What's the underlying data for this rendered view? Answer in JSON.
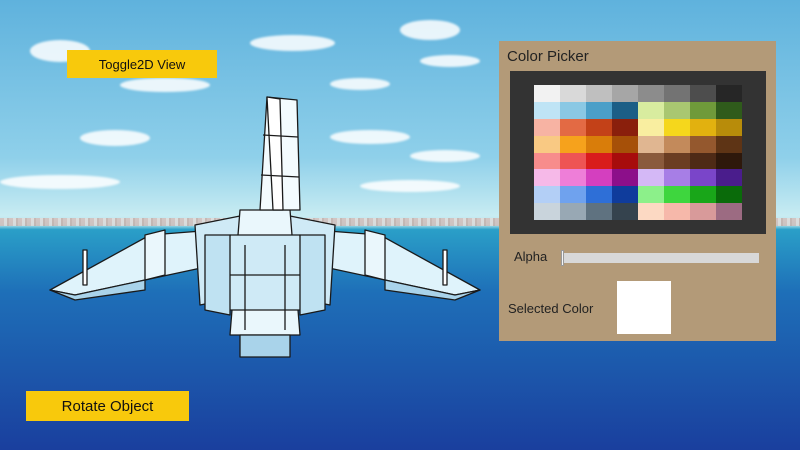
{
  "toolbar": {
    "toggle_label": "Toggle2D View",
    "rotate_label": "Rotate Object"
  },
  "color_picker": {
    "title": "Color Picker",
    "alpha_label": "Alpha",
    "alpha_value": 0,
    "selected_label": "Selected Color",
    "selected_color": "#ffffff",
    "palette": [
      [
        "#f2f2f2",
        "#d9d9d9",
        "#bfbfbf",
        "#a6a6a6",
        "#8c8c8c",
        "#737373",
        "#4d4d4d",
        "#262626"
      ],
      [
        "#bfe4f5",
        "#8ac8e4",
        "#4b9fc8",
        "#1b5e86",
        "#d8ec9f",
        "#a9c771",
        "#6f9a3a",
        "#2f5b1b"
      ],
      [
        "#f7b3a3",
        "#e36a44",
        "#c34118",
        "#8a1f0c",
        "#f9eea0",
        "#f5d71c",
        "#e2b10f",
        "#b88c0a"
      ],
      [
        "#f9c983",
        "#f6a21c",
        "#d97d0a",
        "#a65008",
        "#e0b691",
        "#c38a5b",
        "#94582e",
        "#5e3415"
      ],
      [
        "#f78c8c",
        "#ee5454",
        "#d91c1c",
        "#a70c0c",
        "#8a5a3c",
        "#6b3d22",
        "#4e2a16",
        "#2e180b"
      ],
      [
        "#f6b9e8",
        "#ee7ed8",
        "#d43fbf",
        "#8c0f8a",
        "#d4b8f6",
        "#a77ee6",
        "#7a45c9",
        "#4a1d8c"
      ],
      [
        "#b3cff6",
        "#6fa2ee",
        "#2e6fd7",
        "#0f3c9c",
        "#8cf08a",
        "#3ed63e",
        "#19a619",
        "#0a6b0a"
      ],
      [
        "#c9d4dc",
        "#98a8b4",
        "#5f7280",
        "#35434e",
        "#fcd9c3",
        "#f6b8aa",
        "#d89a9a",
        "#9c6b82"
      ]
    ]
  }
}
